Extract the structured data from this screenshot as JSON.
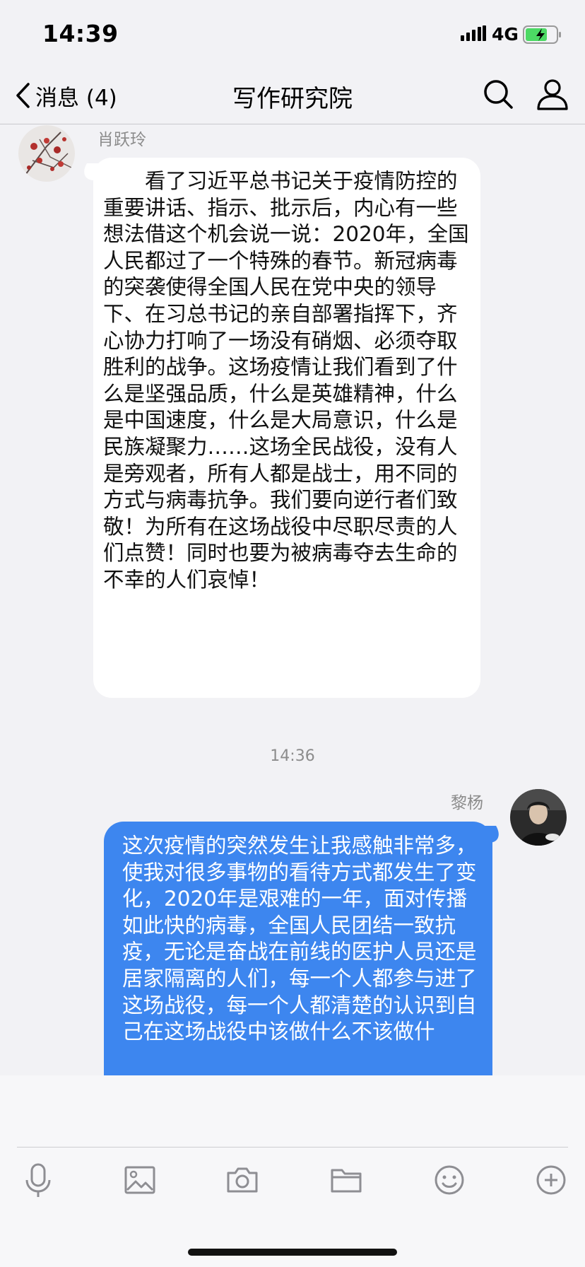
{
  "status_bar": {
    "time": "14:39",
    "network": "4G",
    "signal_icon": "cellular-signal-icon",
    "battery_icon": "battery-charging-icon",
    "battery_color": "#4cd964"
  },
  "nav": {
    "back_label": "消息 (4)",
    "title": "写作研究院",
    "search_icon": "search-icon",
    "profile_icon": "profile-icon"
  },
  "messages": [
    {
      "sender": "肖跃玲",
      "direction": "incoming",
      "text": "　　看了习近平总书记关于疫情防控的重要讲话、指示、批示后，内心有一些想法借这个机会说一说：2020年，全国人民都过了一个特殊的春节。新冠病毒的突袭使得全国人民在党中央的领导下、在习总书记的亲自部署指挥下，齐心协力打响了一场没有硝烟、必须夺取胜利的战争。这场疫情让我们看到了什么是坚强品质，什么是英雄精神，什么是中国速度，什么是大局意识，什么是民族凝聚力……这场全民战役，没有人是旁观者，所有人都是战士，用不同的方式与病毒抗争。我们要向逆行者们致敬！为所有在这场战役中尽职尽责的人们点赞！同时也要为被病毒夺去生命的不幸的人们哀悼！"
    },
    {
      "time": "14:36"
    },
    {
      "sender": "黎杨",
      "direction": "outgoing",
      "text": "这次疫情的突然发生让我感触非常多，使我对很多事物的看待方式都发生了变化，2020年是艰难的一年，面对传播如此快的病毒，全国人民团结一致抗疫，无论是奋战在前线的医护人员还是居家隔离的人们，每一个人都参与进了这场战役，每一个人都清楚的认识到自己在这场战役中该做什么不该做什"
    }
  ],
  "colors": {
    "outgoing_bubble": "#3d86ef",
    "incoming_bubble": "#ffffff",
    "background": "#f2f2f5"
  },
  "toolbar": {
    "items": [
      "microphone-icon",
      "image-icon",
      "camera-icon",
      "folder-icon",
      "emoji-icon",
      "plus-icon"
    ]
  }
}
